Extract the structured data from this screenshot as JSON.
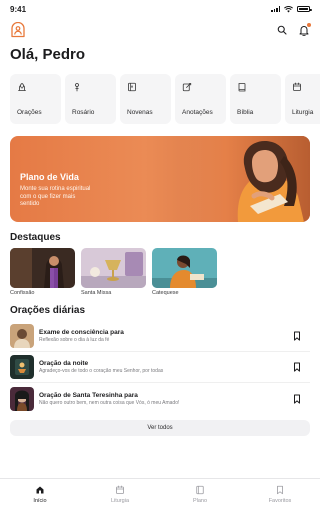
{
  "status_bar": {
    "time": "9:41"
  },
  "greeting": "Olá, Pedro",
  "shortcuts": [
    {
      "label": "Orações",
      "icon": "praying-hands-icon"
    },
    {
      "label": "Rosário",
      "icon": "rosary-icon"
    },
    {
      "label": "Novenas",
      "icon": "book-icon"
    },
    {
      "label": "Anotações",
      "icon": "note-edit-icon"
    },
    {
      "label": "Bíblia",
      "icon": "bible-icon"
    },
    {
      "label": "Liturgia",
      "icon": "calendar-icon"
    }
  ],
  "hero": {
    "title": "Plano de Vida",
    "subtitle": "Monte sua rotina espiritual com o que fizer mais sentido"
  },
  "destaques": {
    "title": "Destaques",
    "items": [
      {
        "label": "Confissão"
      },
      {
        "label": "Santa Missa"
      },
      {
        "label": "Catequese"
      }
    ]
  },
  "oracoes": {
    "title": "Orações diárias",
    "items": [
      {
        "title": "Exame de consciência para",
        "subtitle": "Reflexão sobre o dia à luz da fé"
      },
      {
        "title": "Oração da noite",
        "subtitle": "Agradeço-vos de todo o coração meu Senhor, por todas"
      },
      {
        "title": "Oração de Santa Teresinha para",
        "subtitle": "Não quero outro bem, nem outra coisa que Vós, ó meu Amado!"
      }
    ],
    "see_all": "Ver todos"
  },
  "tabs": [
    {
      "label": "Início",
      "active": true
    },
    {
      "label": "Liturgia",
      "active": false
    },
    {
      "label": "Plano",
      "active": false
    },
    {
      "label": "Favoritos",
      "active": false
    }
  ],
  "colors": {
    "accent": "#e8783a",
    "hero_bg": "#e57a45"
  }
}
